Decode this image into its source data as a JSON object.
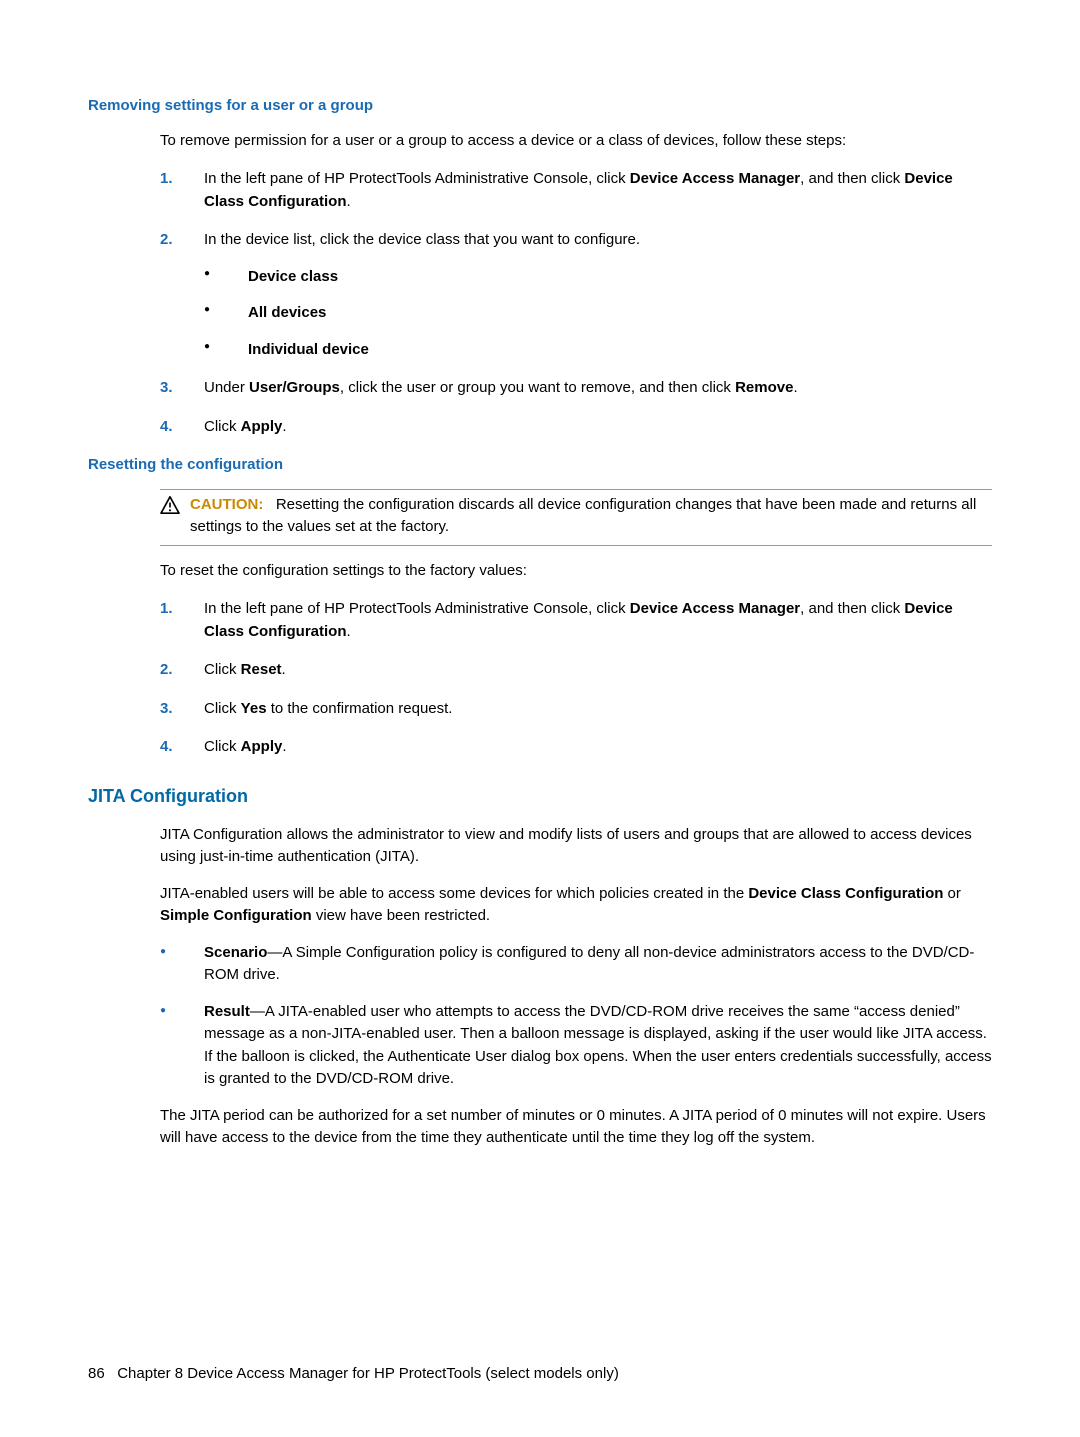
{
  "section1": {
    "heading": "Removing settings for a user or a group",
    "intro": "To remove permission for a user or a group to access a device or a class of devices, follow these steps:",
    "step1_a": "In the left pane of HP ProtectTools Administrative Console, click ",
    "step1_b": "Device Access Manager",
    "step1_c": ", and then click ",
    "step1_d": "Device Class Configuration",
    "step1_e": ".",
    "step2": "In the device list, click the device class that you want to configure.",
    "bullet1": "Device class",
    "bullet2": "All devices",
    "bullet3": "Individual device",
    "step3_a": "Under ",
    "step3_b": "User/Groups",
    "step3_c": ", click the user or group you want to remove, and then click ",
    "step3_d": "Remove",
    "step3_e": ".",
    "step4_a": "Click ",
    "step4_b": "Apply",
    "step4_c": "."
  },
  "section2": {
    "heading": "Resetting the configuration",
    "caution_label": "CAUTION:",
    "caution_text": "Resetting the configuration discards all device configuration changes that have been made and returns all settings to the values set at the factory.",
    "intro": "To reset the configuration settings to the factory values:",
    "step1_a": "In the left pane of HP ProtectTools Administrative Console, click ",
    "step1_b": "Device Access Manager",
    "step1_c": ", and then click ",
    "step1_d": "Device Class Configuration",
    "step1_e": ".",
    "step2_a": "Click ",
    "step2_b": "Reset",
    "step2_c": ".",
    "step3_a": "Click ",
    "step3_b": "Yes",
    "step3_c": " to the confirmation request.",
    "step4_a": "Click ",
    "step4_b": "Apply",
    "step4_c": "."
  },
  "section3": {
    "heading": "JITA Configuration",
    "p1": "JITA Configuration allows the administrator to view and modify lists of users and groups that are allowed to access devices using just-in-time authentication (JITA).",
    "p2_a": "JITA-enabled users will be able to access some devices for which policies created in the ",
    "p2_b": "Device Class Configuration",
    "p2_c": " or ",
    "p2_d": "Simple Configuration",
    "p2_e": " view have been restricted.",
    "b1_a": "Scenario",
    "b1_b": "—A Simple Configuration policy is configured to deny all non-device administrators access to the DVD/CD-ROM drive.",
    "b2_a": "Result",
    "b2_b": "—A JITA-enabled user who attempts to access the DVD/CD-ROM drive receives the same “access denied” message as a non-JITA-enabled user. Then a balloon message is displayed, asking if the user would like JITA access. If the balloon is clicked, the Authenticate User dialog box opens. When the user enters credentials successfully, access is granted to the DVD/CD-ROM drive.",
    "p3": "The JITA period can be authorized for a set number of minutes or 0 minutes. A JITA period of 0 minutes will not expire. Users will have access to the device from the time they authenticate until the time they log off the system."
  },
  "nums": {
    "n1": "1.",
    "n2": "2.",
    "n3": "3.",
    "n4": "4."
  },
  "footer": {
    "page": "86",
    "chapter": "Chapter 8   Device Access Manager for HP ProtectTools (select models only)"
  }
}
